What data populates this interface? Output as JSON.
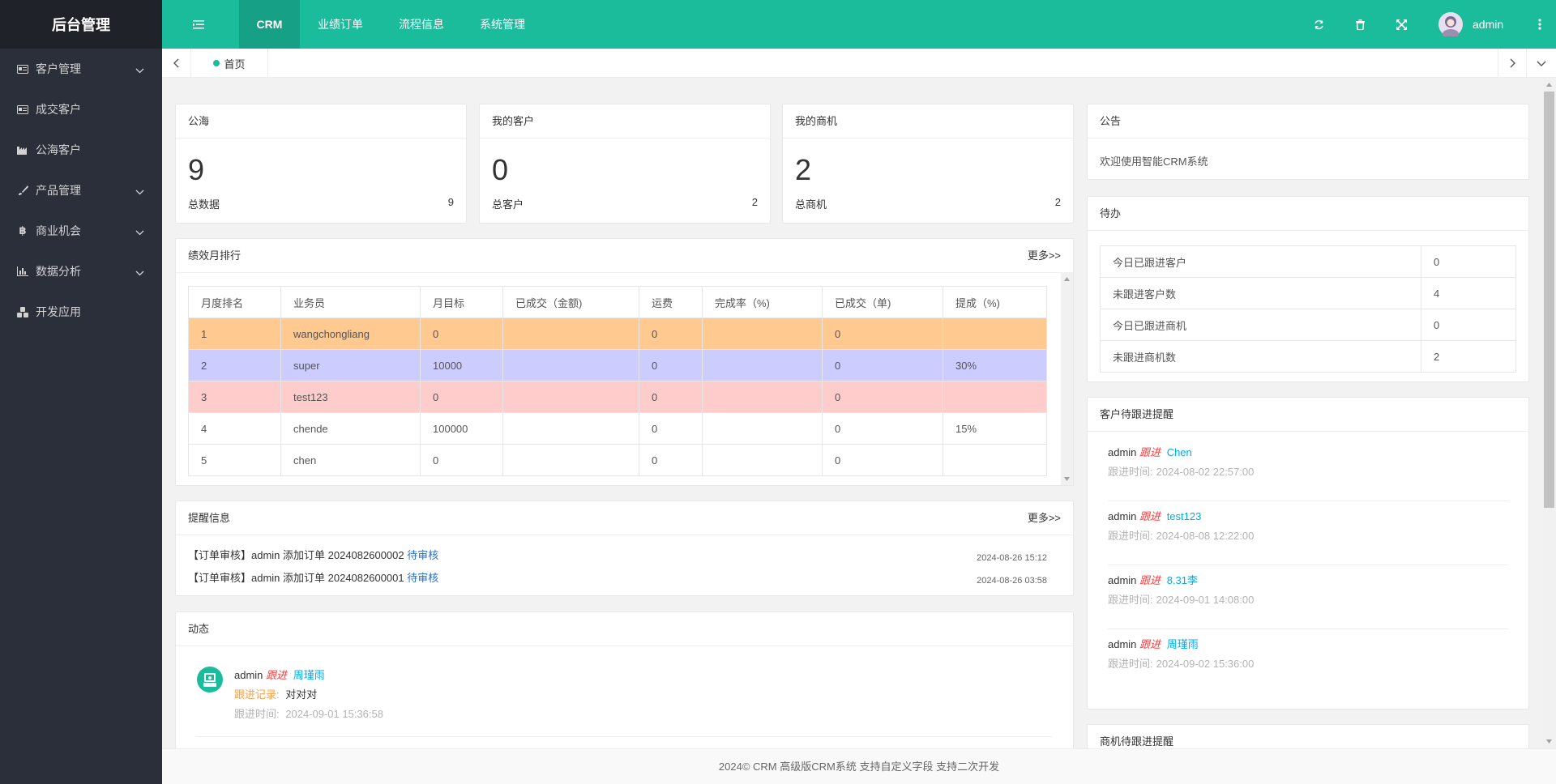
{
  "sidebar": {
    "logo": "后台管理",
    "items": [
      {
        "label": "客户管理",
        "icon": "card-icon",
        "has_children": true
      },
      {
        "label": "成交客户",
        "icon": "card-icon",
        "has_children": false
      },
      {
        "label": "公海客户",
        "icon": "factory-icon",
        "has_children": false
      },
      {
        "label": "产品管理",
        "icon": "brush-icon",
        "has_children": true
      },
      {
        "label": "商业机会",
        "icon": "bitcoin-icon",
        "has_children": true
      },
      {
        "label": "数据分析",
        "icon": "bar-chart-icon",
        "has_children": true
      },
      {
        "label": "开发应用",
        "icon": "cubes-icon",
        "has_children": false
      }
    ]
  },
  "topbar": {
    "tabs": [
      "CRM",
      "业绩订单",
      "流程信息",
      "系统管理"
    ],
    "active_tab": "CRM",
    "user": "admin",
    "colors": {
      "brand": "#1abc9c",
      "active": "#16a085",
      "sidebar": "#2b2f3a"
    }
  },
  "tabbar": {
    "current_tab": "首页"
  },
  "stats": [
    {
      "title": "公海",
      "value": "9",
      "foot_label": "总数据",
      "foot_value": "9"
    },
    {
      "title": "我的客户",
      "value": "0",
      "foot_label": "总客户",
      "foot_value": "2"
    },
    {
      "title": "我的商机",
      "value": "2",
      "foot_label": "总商机",
      "foot_value": "2"
    }
  ],
  "ranking": {
    "title": "绩效月排行",
    "more": "更多>>",
    "headers": [
      "月度排名",
      "业务员",
      "月目标",
      "已成交（金额)",
      "运费",
      "完成率（%)",
      "已成交（单)",
      "提成（%)"
    ],
    "rows": [
      {
        "cells": [
          "1",
          "wangchongliang",
          "0",
          "",
          "0",
          "",
          "0",
          ""
        ],
        "bg": "#ffc990"
      },
      {
        "cells": [
          "2",
          "super",
          "10000",
          "",
          "0",
          "",
          "0",
          "30%"
        ],
        "bg": "#ccccff"
      },
      {
        "cells": [
          "3",
          "test123",
          "0",
          "",
          "0",
          "",
          "0",
          ""
        ],
        "bg": "#ffcccc"
      },
      {
        "cells": [
          "4",
          "chende",
          "100000",
          "",
          "0",
          "",
          "0",
          "15%"
        ],
        "bg": "#ffffff"
      },
      {
        "cells": [
          "5",
          "chen",
          "0",
          "",
          "0",
          "",
          "0",
          ""
        ],
        "bg": "#ffffff"
      }
    ]
  },
  "reminders": {
    "title": "提醒信息",
    "more": "更多>>",
    "items": [
      {
        "text": "【订单审核】admin 添加订单 2024082600002",
        "link": "待审核",
        "time": "2024-08-26 15:12"
      },
      {
        "text": "【订单审核】admin 添加订单 2024082600001",
        "link": "待审核",
        "time": "2024-08-26 03:58"
      }
    ]
  },
  "activity": {
    "title": "动态",
    "item": {
      "user": "admin",
      "action": "跟进",
      "target": "周瑾雨",
      "record_label": "跟进记录:",
      "record": "对对对",
      "time_label": "跟进时间:",
      "time": "2024-09-01 15:36:58"
    }
  },
  "notice": {
    "title": "公告",
    "text": "欢迎使用智能CRM系统"
  },
  "todo": {
    "title": "待办",
    "rows": [
      {
        "label": "今日已跟进客户",
        "value": "0"
      },
      {
        "label": "未跟进客户数",
        "value": "4"
      },
      {
        "label": "今日已跟进商机",
        "value": "0"
      },
      {
        "label": "未跟进商机数",
        "value": "2"
      }
    ]
  },
  "customer_follow": {
    "title": "客户待跟进提醒",
    "items": [
      {
        "user": "admin",
        "action": "跟进",
        "target": "Chen",
        "time_label": "跟进时间:",
        "time": "2024-08-02 22:57:00"
      },
      {
        "user": "admin",
        "action": "跟进",
        "target": "test123",
        "time_label": "跟进时间:",
        "time": "2024-08-08 12:22:00"
      },
      {
        "user": "admin",
        "action": "跟进",
        "target": "8.31李",
        "time_label": "跟进时间:",
        "time": "2024-09-01 14:08:00"
      },
      {
        "user": "admin",
        "action": "跟进",
        "target": "周瑾雨",
        "time_label": "跟进时间:",
        "time": "2024-09-02 15:36:00"
      }
    ]
  },
  "opportunity_follow": {
    "title": "商机待跟进提醒"
  },
  "footer": {
    "text": "2024© CRM 高级版CRM系统 支持自定义字段 支持二次开发"
  }
}
